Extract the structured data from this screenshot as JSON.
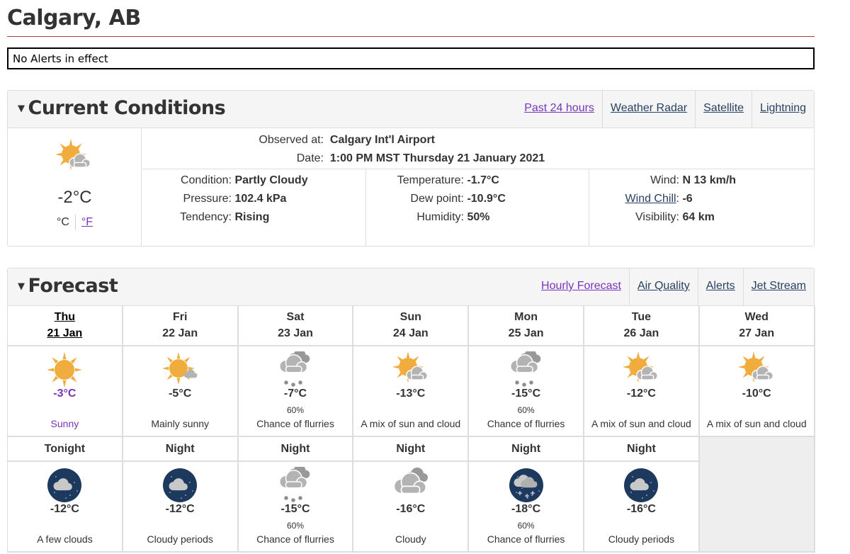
{
  "page": {
    "title": "Calgary, AB",
    "alert_text": "No Alerts in effect"
  },
  "current": {
    "heading": "Current Conditions",
    "links": [
      {
        "label": "Past 24 hours",
        "visited": true
      },
      {
        "label": "Weather Radar",
        "visited": false
      },
      {
        "label": "Satellite",
        "visited": false
      },
      {
        "label": "Lightning",
        "visited": false
      }
    ],
    "icon": "sun-cloud-icon",
    "temp": "-2°C",
    "unit_c": "°C",
    "unit_f": "°F",
    "observed_label": "Observed at:",
    "observed_value": "Calgary Int'l Airport",
    "date_label": "Date:",
    "date_value": "1:00 PM MST Thursday 21 January 2021",
    "condition_label": "Condition:",
    "condition_value": "Partly Cloudy",
    "pressure_label": "Pressure:",
    "pressure_value": "102.4 kPa",
    "tendency_label": "Tendency:",
    "tendency_value": "Rising",
    "temperature_label": "Temperature:",
    "temperature_value": "-1.7°C",
    "dewpoint_label": "Dew point:",
    "dewpoint_value": "-10.9°C",
    "humidity_label": "Humidity:",
    "humidity_value": "50%",
    "wind_label": "Wind:",
    "wind_value": "N 13 km/h",
    "windchill_label": "Wind Chill",
    "windchill_value": "-6",
    "visibility_label": "Visibility:",
    "visibility_value": "64 km"
  },
  "forecast": {
    "heading": "Forecast",
    "links": [
      {
        "label": "Hourly Forecast",
        "visited": true
      },
      {
        "label": "Air Quality",
        "visited": false
      },
      {
        "label": "Alerts",
        "visited": false
      },
      {
        "label": "Jet Stream",
        "visited": false
      }
    ],
    "days": [
      {
        "day": "Thu",
        "date": "21 Jan",
        "today": true,
        "icon": "sun",
        "temp": "-3°C",
        "pop": "",
        "summary": "Sunny"
      },
      {
        "day": "Fri",
        "date": "22 Jan",
        "today": false,
        "icon": "sun-small-cloud",
        "temp": "-5°C",
        "pop": "",
        "summary": "Mainly sunny"
      },
      {
        "day": "Sat",
        "date": "23 Jan",
        "today": false,
        "icon": "flurries",
        "temp": "-7°C",
        "pop": "60%",
        "summary": "Chance of flurries"
      },
      {
        "day": "Sun",
        "date": "24 Jan",
        "today": false,
        "icon": "sun-cloud",
        "temp": "-13°C",
        "pop": "",
        "summary": "A mix of sun and cloud"
      },
      {
        "day": "Mon",
        "date": "25 Jan",
        "today": false,
        "icon": "flurries",
        "temp": "-15°C",
        "pop": "60%",
        "summary": "Chance of flurries"
      },
      {
        "day": "Tue",
        "date": "26 Jan",
        "today": false,
        "icon": "sun-cloud",
        "temp": "-12°C",
        "pop": "",
        "summary": "A mix of sun and cloud"
      },
      {
        "day": "Wed",
        "date": "27 Jan",
        "today": false,
        "icon": "sun-cloud",
        "temp": "-10°C",
        "pop": "",
        "summary": "A mix of sun and cloud"
      }
    ],
    "nights": [
      {
        "label": "Tonight",
        "icon": "night-cloud",
        "temp": "-12°C",
        "pop": "",
        "summary": "A few clouds"
      },
      {
        "label": "Night",
        "icon": "night-cloud",
        "temp": "-12°C",
        "pop": "",
        "summary": "Cloudy periods"
      },
      {
        "label": "Night",
        "icon": "flurries",
        "temp": "-15°C",
        "pop": "60%",
        "summary": "Chance of flurries"
      },
      {
        "label": "Night",
        "icon": "cloudy",
        "temp": "-16°C",
        "pop": "",
        "summary": "Cloudy"
      },
      {
        "label": "Night",
        "icon": "night-flurries",
        "temp": "-18°C",
        "pop": "60%",
        "summary": "Chance of flurries"
      },
      {
        "label": "Night",
        "icon": "night-cloud",
        "temp": "-16°C",
        "pop": "",
        "summary": "Cloudy periods"
      }
    ]
  },
  "colors": {
    "sun": "#f0ac3c",
    "cloud": "#b3b3b3",
    "cloud_dark": "#999999",
    "night": "#1d3a5e",
    "moon": "#f5f1c8",
    "highlight": "#7834bc",
    "title_rule": "#af3c43"
  }
}
